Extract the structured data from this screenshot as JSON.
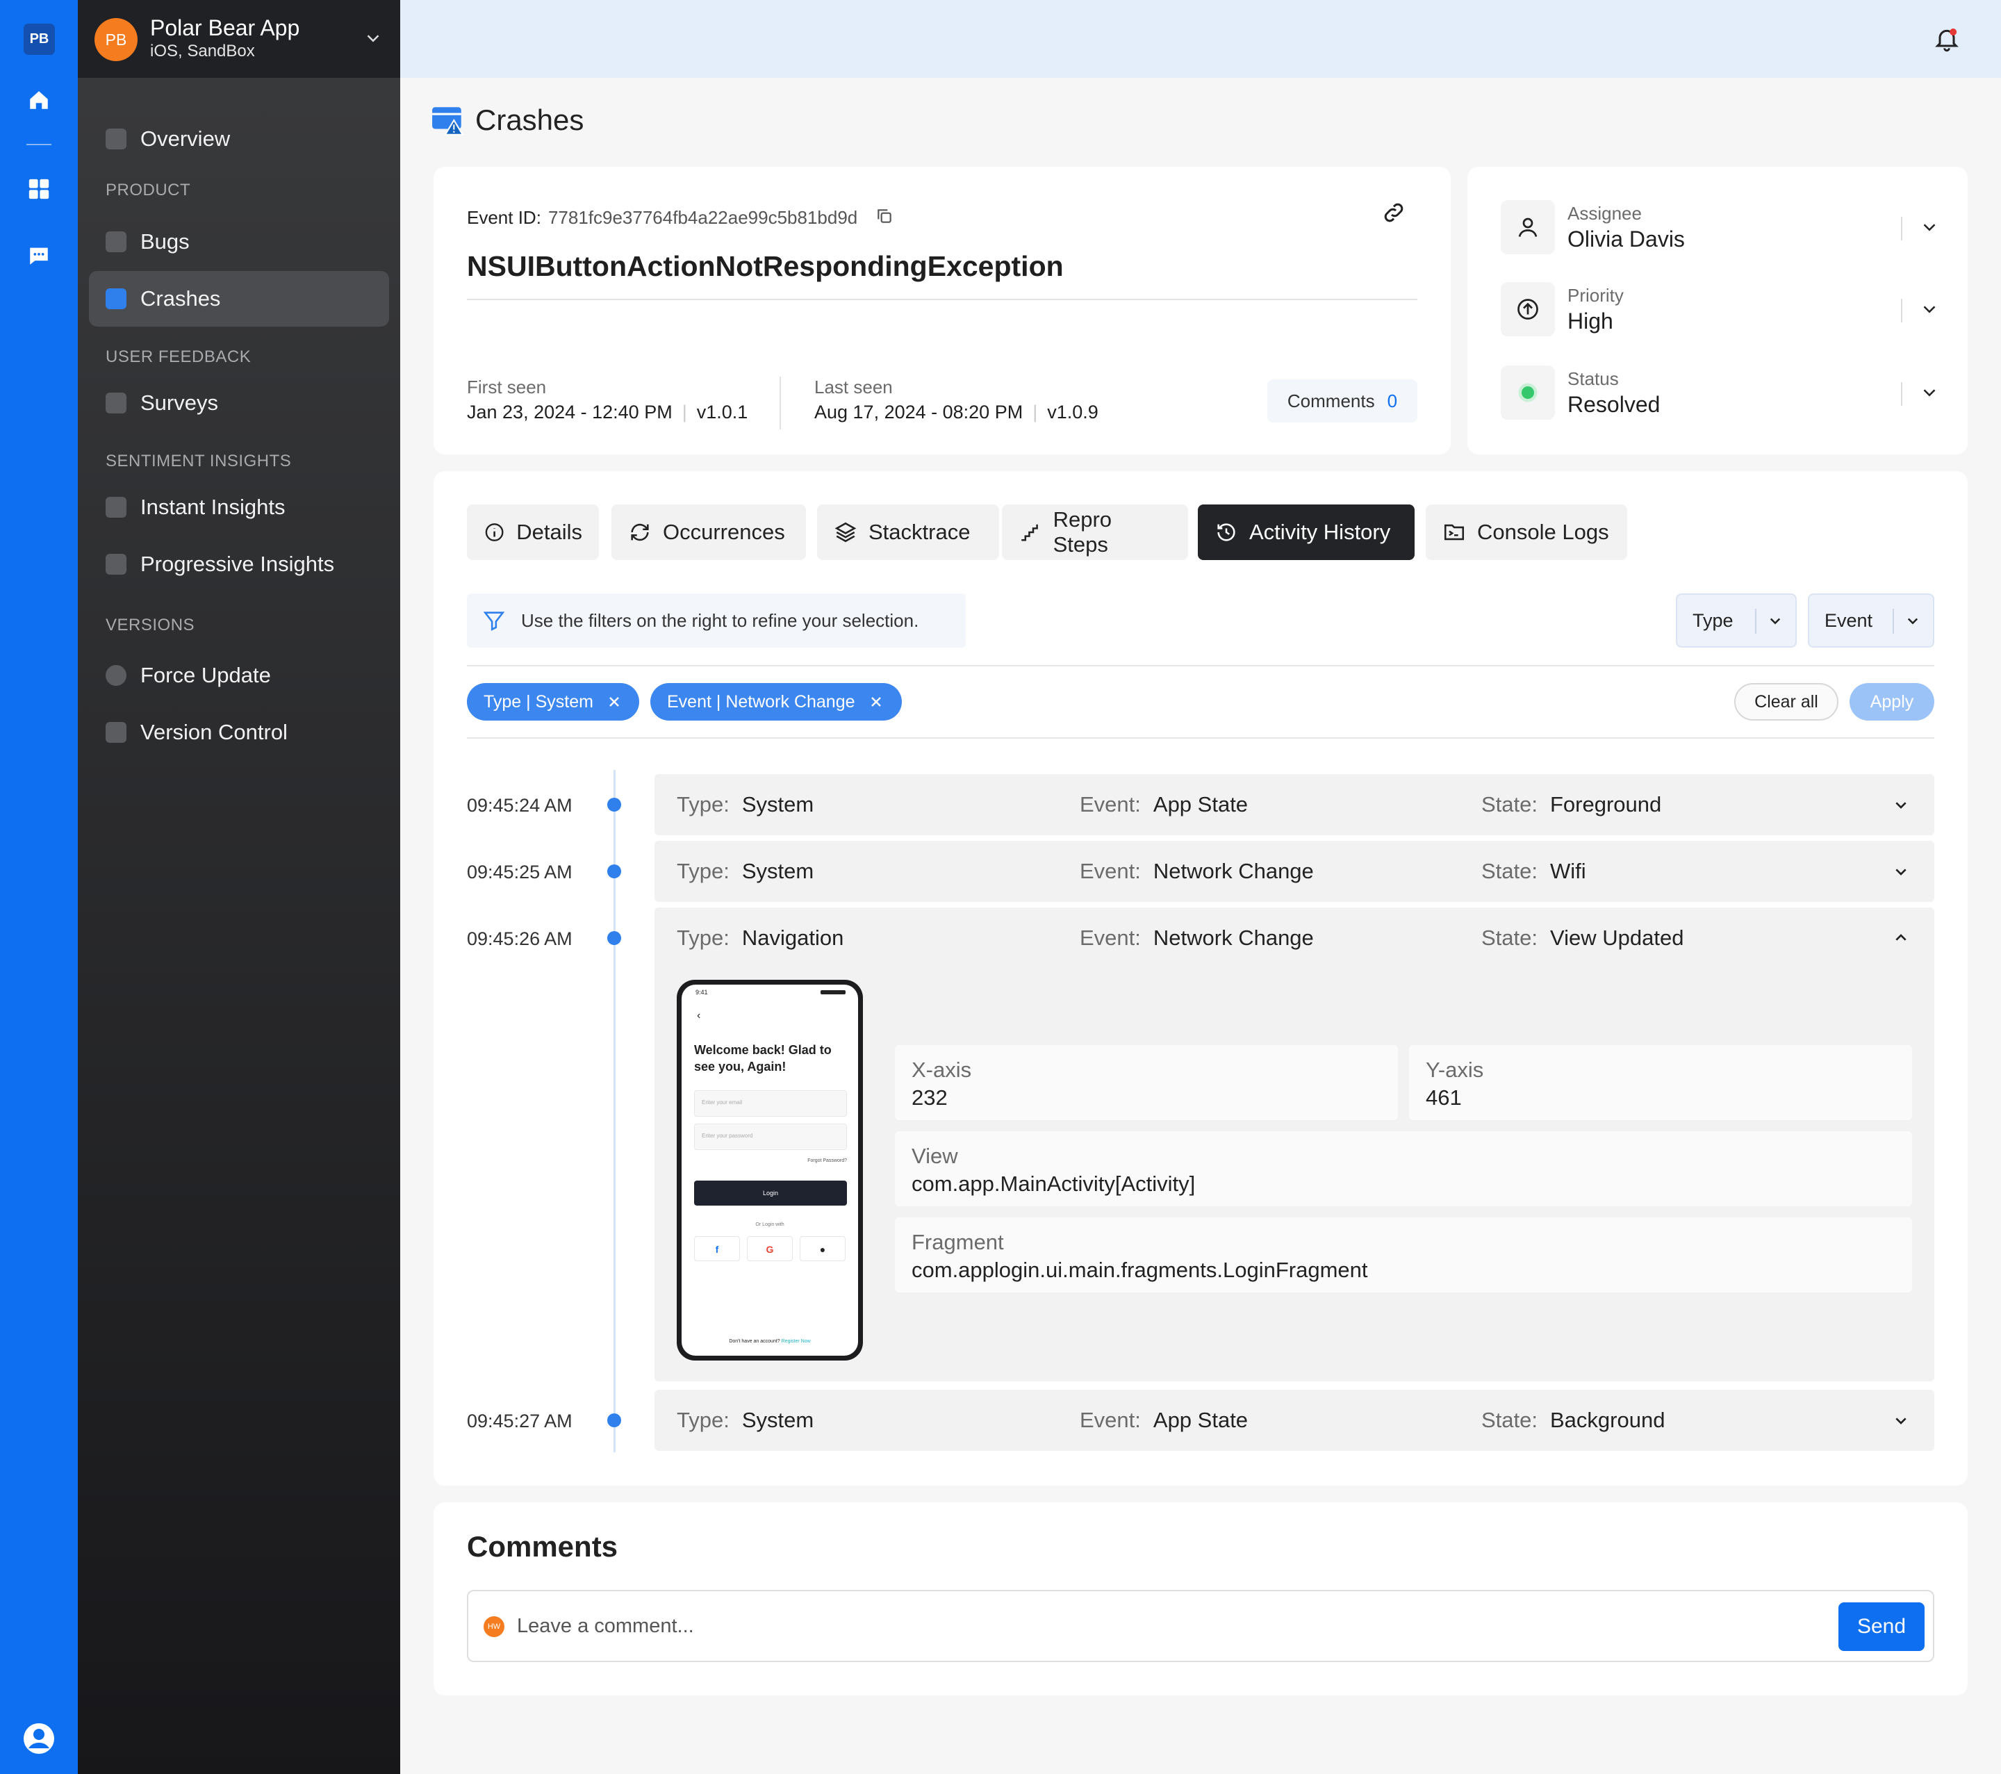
{
  "rail": {
    "logo": "PB"
  },
  "app": {
    "avatar": "PB",
    "name": "Polar Bear App",
    "sub": "iOS, SandBox"
  },
  "nav": {
    "overview": "Overview",
    "sec_product": "PRODUCT",
    "bugs": "Bugs",
    "crashes": "Crashes",
    "sec_feedback": "USER FEEDBACK",
    "surveys": "Surveys",
    "sec_sentiment": "SENTIMENT INSIGHTS",
    "instant": "Instant Insights",
    "progressive": "Progressive Insights",
    "sec_versions": "VERSIONS",
    "force": "Force Update",
    "version": "Version Control"
  },
  "page": {
    "title": "Crashes"
  },
  "event": {
    "id_label": "Event ID:",
    "id": "7781fc9e37764fb4a22ae99c5b81bd9d",
    "name": "NSUIButtonActionNotRespondingException",
    "first_label": "First seen",
    "first_date": "Jan 23, 2024 - 12:40 PM",
    "first_ver": "v1.0.1",
    "last_label": "Last seen",
    "last_date": "Aug 17, 2024 - 08:20 PM",
    "last_ver": "v1.0.9",
    "comments_label": "Comments",
    "comments_count": "0"
  },
  "meta": {
    "assignee_label": "Assignee",
    "assignee": "Olivia Davis",
    "priority_label": "Priority",
    "priority": "High",
    "status_label": "Status",
    "status": "Resolved",
    "status_color": "#35c76b"
  },
  "tabs": {
    "details": "Details",
    "occurrences": "Occurrences",
    "stacktrace": "Stacktrace",
    "repro": "Repro Steps",
    "activity": "Activity History",
    "console": "Console Logs"
  },
  "filter": {
    "hint": "Use the filters on the right to refine your selection.",
    "type": "Type",
    "event": "Event",
    "chip1": "Type | System",
    "chip2": "Event | Network Change",
    "clear": "Clear all",
    "apply": "Apply"
  },
  "labels": {
    "type": "Type:",
    "event": "Event:",
    "state": "State:"
  },
  "timeline": [
    {
      "time": "09:45:24 AM",
      "type": "System",
      "event": "App State",
      "state": "Foreground"
    },
    {
      "time": "09:45:25 AM",
      "type": "System",
      "event": "Network Change",
      "state": "Wifi"
    },
    {
      "time": "09:45:26 AM",
      "type": "Navigation",
      "event": "Network Change",
      "state": "View Updated"
    },
    {
      "time": "09:45:27 AM",
      "type": "System",
      "event": "App State",
      "state": "Background"
    }
  ],
  "detail": {
    "x_label": "X-axis",
    "x": "232",
    "y_label": "Y-axis",
    "y": "461",
    "view_label": "View",
    "view": "com.app.MainActivity[Activity]",
    "frag_label": "Fragment",
    "frag": "com.applogin.ui.main.fragments.LoginFragment"
  },
  "phone": {
    "clock": "9:41",
    "title": "Welcome back! Glad to see you, Again!",
    "email": "Enter your email",
    "password": "Enter your password",
    "forgot": "Forgot Password?",
    "login": "Login",
    "or": "Or Login with",
    "noacct": "Don't have an account?",
    "register": "Register Now"
  },
  "comments": {
    "title": "Comments",
    "avatar": "HW",
    "placeholder": "Leave a comment...",
    "send": "Send"
  },
  "colors": {
    "accent": "#0e6ff0",
    "chip": "#3c86f0",
    "dot": "#2f80ed"
  }
}
